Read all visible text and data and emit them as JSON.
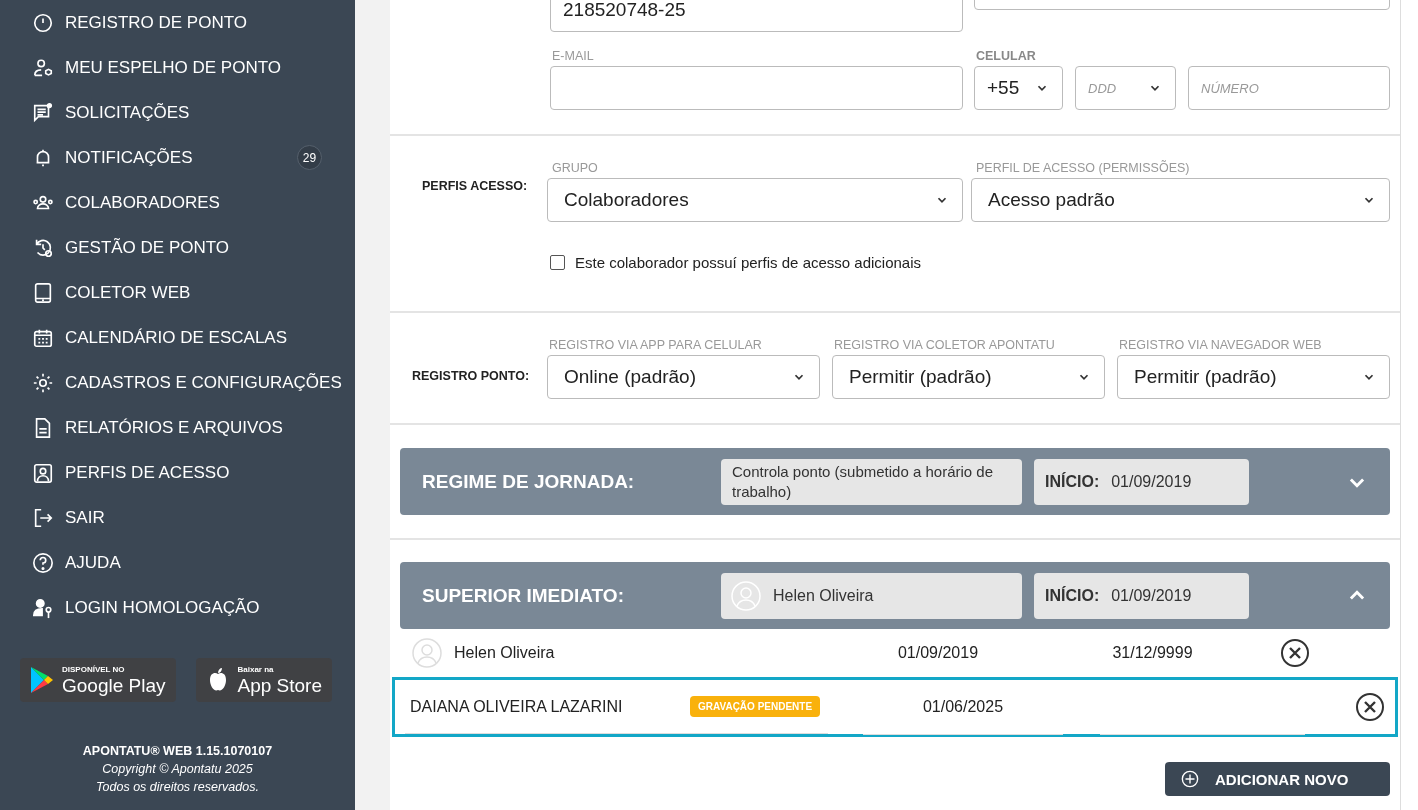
{
  "sidebar": {
    "items": [
      {
        "label": "REGISTRO DE PONTO"
      },
      {
        "label": "MEU ESPELHO DE PONTO"
      },
      {
        "label": "SOLICITAÇÕES"
      },
      {
        "label": "NOTIFICAÇÕES",
        "badge": "29"
      },
      {
        "label": "COLABORADORES"
      },
      {
        "label": "GESTÃO DE PONTO"
      },
      {
        "label": "COLETOR WEB"
      },
      {
        "label": "CALENDÁRIO DE ESCALAS"
      },
      {
        "label": "CADASTROS E CONFIGURAÇÕES"
      },
      {
        "label": "RELATÓRIOS E ARQUIVOS"
      },
      {
        "label": "PERFIS DE ACESSO"
      },
      {
        "label": "SAIR"
      },
      {
        "label": "AJUDA"
      },
      {
        "label": "LOGIN HOMOLOGAÇÃO"
      }
    ],
    "stores": [
      {
        "kind": "google",
        "small": "DISPONÍVEL NO",
        "big": "Google Play"
      },
      {
        "kind": "apple",
        "small": "Baixar na",
        "big": "App Store"
      }
    ],
    "footer": {
      "version": "APONTATU® WEB 1.15.1070107",
      "copyright": "Copyright © Apontatu 2025",
      "rights": "Todos os direitos reservados."
    }
  },
  "contact": {
    "document": "218520748-25",
    "email": {
      "label": "E-MAIL"
    },
    "celular": {
      "label": "CELULAR",
      "country": "+55",
      "ddd": "DDD",
      "numero": {
        "placeholder": "NÚMERO"
      }
    }
  },
  "perfis": {
    "label": "PERFIS ACESSO:",
    "grupo": {
      "label": "GRUPO",
      "value": "Colaboradores"
    },
    "perfil": {
      "label": "PERFIL DE ACESSO (PERMISSÕES)",
      "value": "Acesso padrão"
    },
    "checkbox": {
      "label": "Este colaborador possuí perfis de acesso adicionais",
      "checked": false
    }
  },
  "registro": {
    "label": "REGISTRO PONTO:",
    "selects": [
      {
        "label": "REGISTRO VIA APP PARA CELULAR",
        "value": "Online (padrão)"
      },
      {
        "label": "REGISTRO VIA COLETOR APONTATU",
        "value": "Permitir (padrão)"
      },
      {
        "label": "REGISTRO VIA NAVEGADOR WEB",
        "value": "Permitir (padrão)"
      }
    ]
  },
  "regime": {
    "title": "REGIME DE JORNADA:",
    "value": "Controla ponto (submetido a horário de trabalho)",
    "inicio_label": "INÍCIO:",
    "inicio": "01/09/2019",
    "expanded": false
  },
  "superior": {
    "title": "SUPERIOR IMEDIATO:",
    "name": "Helen Oliveira",
    "inicio_label": "INÍCIO:",
    "inicio": "01/09/2019",
    "expanded": true,
    "rows": [
      {
        "name": "Helen Oliveira",
        "avatar": true,
        "start": "01/09/2019",
        "end": "31/12/9999",
        "selected": false
      },
      {
        "name": "DAIANA OLIVEIRA LAZARINI",
        "avatar": false,
        "badge": "GRAVAÇÃO PENDENTE",
        "start": "01/06/2025",
        "selected": true
      }
    ]
  },
  "add_button": "ADICIONAR NOVO"
}
